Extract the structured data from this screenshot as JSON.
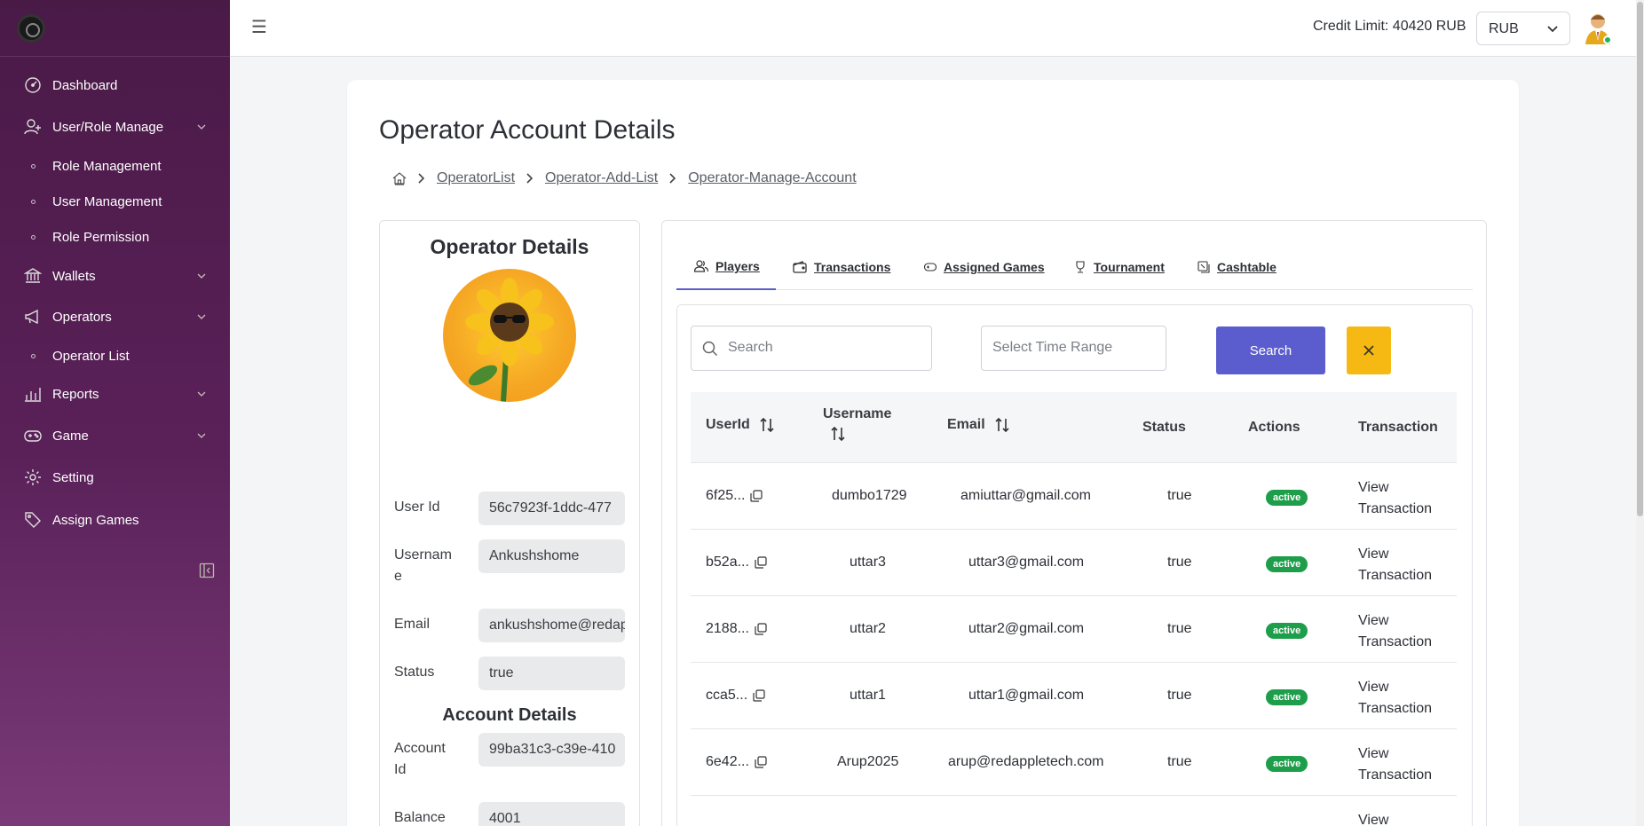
{
  "sidebar": {
    "items": [
      {
        "label": "Dashboard"
      },
      {
        "label": "User/Role Manage"
      },
      {
        "label": "Role Management"
      },
      {
        "label": "User Management"
      },
      {
        "label": "Role Permission"
      },
      {
        "label": "Wallets"
      },
      {
        "label": "Operators"
      },
      {
        "label": "Operator List"
      },
      {
        "label": "Reports"
      },
      {
        "label": "Game"
      },
      {
        "label": "Setting"
      },
      {
        "label": "Assign Games"
      }
    ]
  },
  "topbar": {
    "credit_limit": "Credit Limit: 40420 RUB",
    "currency": "RUB"
  },
  "page": {
    "title": "Operator Account Details",
    "breadcrumb": [
      "OperatorList",
      "Operator-Add-List",
      "Operator-Manage-Account"
    ]
  },
  "operator": {
    "title": "Operator Details",
    "fields": {
      "user_id_label": "User Id",
      "user_id": "56c7923f-1ddc-477",
      "username_label": "Usernam\ne",
      "username": "Ankushshome",
      "email_label": "Email",
      "email": "ankushshome@redapple",
      "status_label": "Status",
      "status": "true"
    },
    "account_title": "Account Details",
    "account": {
      "account_id_label": "Account\nId",
      "account_id": "99ba31c3-c39e-410",
      "balance_label": "Balance",
      "balance": "4001"
    }
  },
  "tabs": [
    {
      "label": "Players"
    },
    {
      "label": "Transactions"
    },
    {
      "label": "Assigned Games"
    },
    {
      "label": "Tournament"
    },
    {
      "label": "Cashtable"
    }
  ],
  "filters": {
    "search_placeholder": "Search",
    "time_placeholder": "Select Time Range",
    "search_button": "Search"
  },
  "table": {
    "columns": [
      "UserId",
      "Username",
      "Email",
      "Status",
      "Actions",
      "Transaction"
    ],
    "rows": [
      {
        "user_id": "6f25...",
        "username": "dumbo1729",
        "email": "amiuttar@gmail.com",
        "status": "true",
        "action": "active",
        "transaction": "View Transaction"
      },
      {
        "user_id": "b52a...",
        "username": "uttar3",
        "email": "uttar3@gmail.com",
        "status": "true",
        "action": "active",
        "transaction": "View Transaction"
      },
      {
        "user_id": "2188...",
        "username": "uttar2",
        "email": "uttar2@gmail.com",
        "status": "true",
        "action": "active",
        "transaction": "View Transaction"
      },
      {
        "user_id": "cca5...",
        "username": "uttar1",
        "email": "uttar1@gmail.com",
        "status": "true",
        "action": "active",
        "transaction": "View Transaction"
      },
      {
        "user_id": "6e42...",
        "username": "Arup2025",
        "email": "arup@redappletech.com",
        "status": "true",
        "action": "active",
        "transaction": "View Transaction"
      },
      {
        "user_id": "",
        "username": "",
        "email": "",
        "status": "",
        "action": "",
        "transaction": "View"
      }
    ]
  },
  "colors": {
    "sidebar_top": "#4a1a47",
    "accent": "#5b5ccd",
    "warning": "#f6b913",
    "success": "#1e9e4a"
  }
}
